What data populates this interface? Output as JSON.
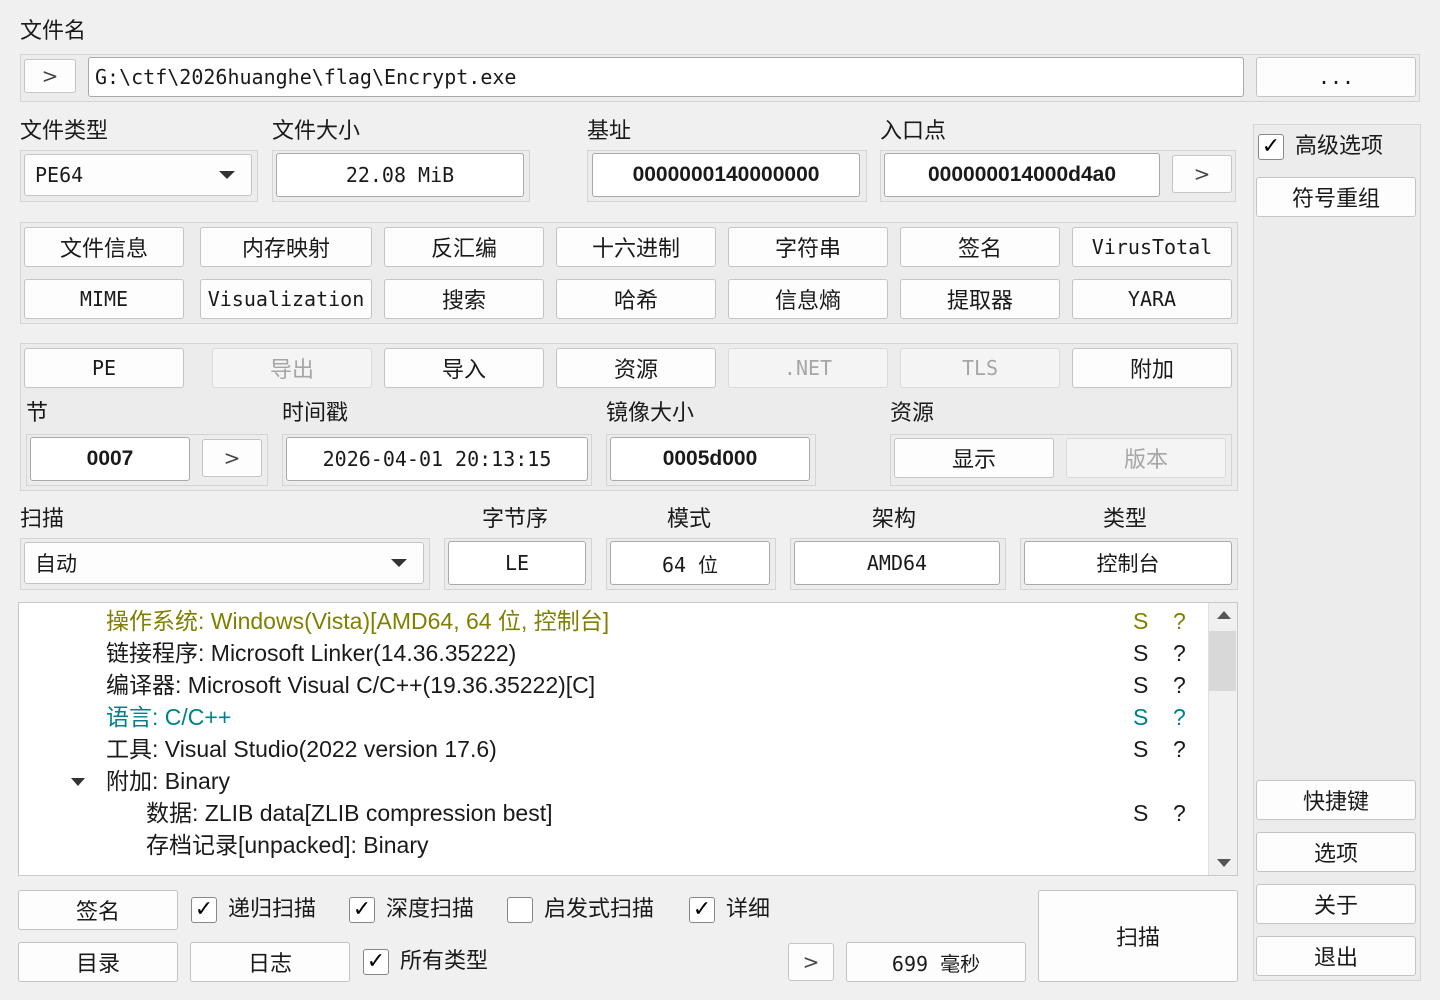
{
  "file": {
    "label": "文件名",
    "path": "G:\\ctf\\2026huanghe\\flag\\Encrypt.exe",
    "browse_label": "...",
    "expand_icon": "chevron-right-icon"
  },
  "fileinfo": {
    "type_label": "文件类型",
    "type_value": "PE64",
    "size_label": "文件大小",
    "size_value": "22.08 MiB",
    "base_label": "基址",
    "base_value": "0000000140000000",
    "entry_label": "入口点",
    "entry_value": "000000014000d4a0"
  },
  "right_panel": {
    "advanced_label": "高级选项",
    "advanced_checked": true,
    "demangle_label": "符号重组",
    "shortcuts_label": "快捷键",
    "options_label": "选项",
    "about_label": "关于",
    "exit_label": "退出"
  },
  "tools": {
    "row1": [
      "文件信息",
      "内存映射",
      "反汇编",
      "十六进制",
      "字符串",
      "签名",
      "VirusTotal"
    ],
    "row2": [
      "MIME",
      "Visualization",
      "搜索",
      "哈希",
      "信息熵",
      "提取器",
      "YARA"
    ]
  },
  "pe": {
    "pe_label": "PE",
    "export_label": "导出",
    "import_label": "导入",
    "resource_label": "资源",
    "net_label": ".NET",
    "tls_label": "TLS",
    "overlay_label": "附加",
    "section_label": "节",
    "section_value": "0007",
    "timestamp_label": "时间戳",
    "timestamp_value": "2026-04-01 20:13:15",
    "image_size_label": "镜像大小",
    "image_size_value": "0005d000",
    "res_label": "资源",
    "show_label": "显示",
    "version_label": "版本"
  },
  "scan": {
    "scan_label": "扫描",
    "mode_value": "自动",
    "endian_label": "字节序",
    "endian_value": "LE",
    "mode_label": "模式",
    "bits_value": "64 位",
    "arch_label": "架构",
    "arch_value": "AMD64",
    "type_label": "类型",
    "type_value": "控制台"
  },
  "results": [
    {
      "text": "操作系统: Windows(Vista)[AMD64, 64 位, 控制台]",
      "s": "S",
      "q": "?",
      "color": "#808000",
      "indent": 1
    },
    {
      "text": "链接程序: Microsoft Linker(14.36.35222)",
      "s": "S",
      "q": "?",
      "color": "#1a1a1a",
      "indent": 1
    },
    {
      "text": "编译器: Microsoft Visual C/C++(19.36.35222)[C]",
      "s": "S",
      "q": "?",
      "color": "#1a1a1a",
      "indent": 1
    },
    {
      "text": "语言: C/C++",
      "s": "S",
      "q": "?",
      "color": "#00808a",
      "indent": 1
    },
    {
      "text": "工具: Visual Studio(2022 version 17.6)",
      "s": "S",
      "q": "?",
      "color": "#1a1a1a",
      "indent": 1
    },
    {
      "text": "附加: Binary",
      "s": "",
      "q": "",
      "color": "#1a1a1a",
      "indent": 1,
      "expanded": true
    },
    {
      "text": "数据: ZLIB data[ZLIB compression best]",
      "s": "S",
      "q": "?",
      "color": "#1a1a1a",
      "indent": 2
    },
    {
      "text": "存档记录[unpacked]: Binary",
      "s": "",
      "q": "",
      "color": "#1a1a1a",
      "indent": 2
    }
  ],
  "bottom": {
    "signature_label": "签名",
    "dir_label": "目录",
    "log_label": "日志",
    "recursive_label": "递归扫描",
    "recursive_checked": true,
    "deep_label": "深度扫描",
    "deep_checked": true,
    "heuristic_label": "启发式扫描",
    "heuristic_checked": false,
    "verbose_label": "详细",
    "verbose_checked": true,
    "alltypes_label": "所有类型",
    "alltypes_checked": true,
    "time_value": "699 毫秒",
    "scan_button_label": "扫描"
  }
}
